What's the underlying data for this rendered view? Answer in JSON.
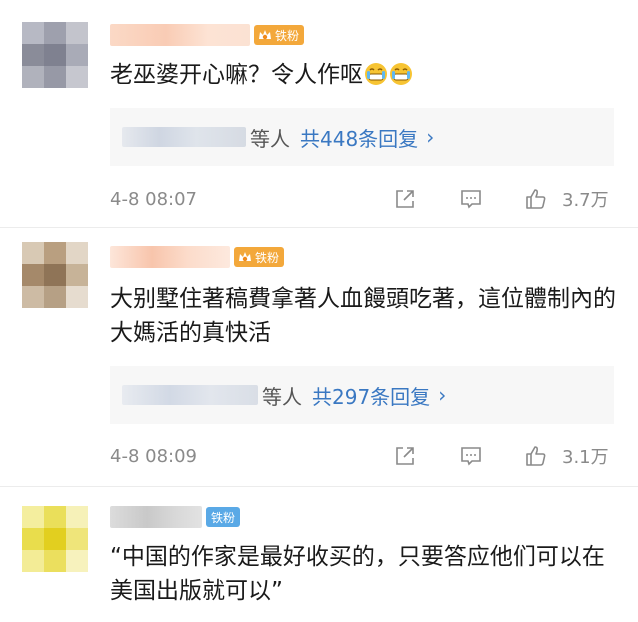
{
  "comments": [
    {
      "text": "老巫婆开心嘛？令人作呕",
      "badge": "铁粉",
      "reply_who": "等人",
      "reply_count": "共448条回复",
      "chevron": "›",
      "time": "4-8 08:07",
      "likes": "3.7万"
    },
    {
      "text": "大别墅住著稿費拿著人血饅頭吃著，這位體制內的大媽活的真快活",
      "badge": "铁粉",
      "reply_who": "等人",
      "reply_count": "共297条回复",
      "chevron": "›",
      "time": "4-8 08:09",
      "likes": "3.1万"
    },
    {
      "text": "“中国的作家是最好收买的，只要答应他们可以在美国出版就可以”",
      "badge": "铁粉"
    }
  ],
  "icons": {
    "share": "share-icon",
    "comment": "comment-icon",
    "like": "like-icon",
    "crown": "crown-icon",
    "emoji": "grimace-emoji-icon"
  },
  "colors": {
    "link_blue": "#3a78c2",
    "meta_gray": "#8a8a8a",
    "badge_gold": "#f3a83b",
    "badge_blue": "#5aa9e6",
    "reply_bg": "#f7f7f7"
  }
}
